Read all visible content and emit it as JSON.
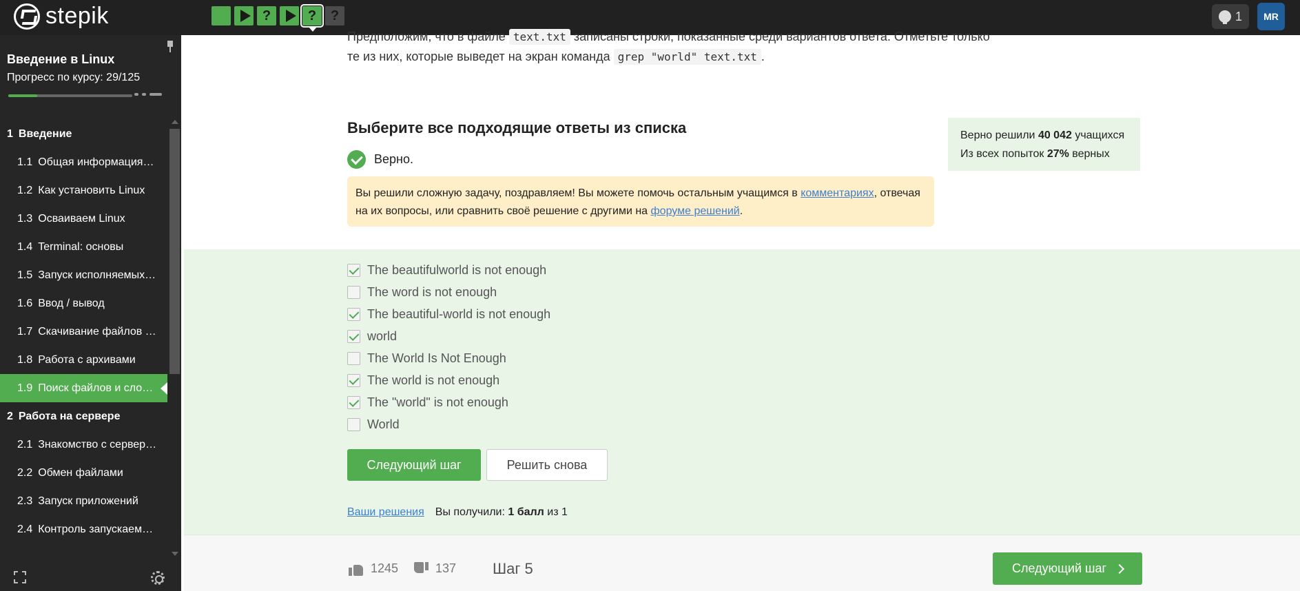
{
  "topbar": {
    "logo_text": "stepik",
    "steps": [
      {
        "type": "text",
        "symbol": ""
      },
      {
        "type": "code",
        "symbol": "play"
      },
      {
        "type": "quiz",
        "symbol": "?"
      },
      {
        "type": "code",
        "symbol": "play"
      },
      {
        "type": "quiz",
        "symbol": "?",
        "active": true
      },
      {
        "type": "quiz",
        "symbol": "?",
        "unsolved": true
      }
    ],
    "notifications_count": "1",
    "avatar_initials": "MR"
  },
  "sidebar": {
    "course_title": "Введение в Linux",
    "progress_label": "Прогресс по курсу:  29/125",
    "progress_fraction": 0.232,
    "toc": [
      {
        "kind": "module",
        "num": "1",
        "title": "Введение"
      },
      {
        "kind": "lesson",
        "num": "1.1",
        "title": "Общая информация о курсе"
      },
      {
        "kind": "lesson",
        "num": "1.2",
        "title": "Как установить Linux"
      },
      {
        "kind": "lesson",
        "num": "1.3",
        "title": "Осваиваем Linux"
      },
      {
        "kind": "lesson",
        "num": "1.4",
        "title": "Terminal: основы"
      },
      {
        "kind": "lesson",
        "num": "1.5",
        "title": "Запуск исполняемых файлов"
      },
      {
        "kind": "lesson",
        "num": "1.6",
        "title": "Ввод / вывод"
      },
      {
        "kind": "lesson",
        "num": "1.7",
        "title": "Скачивание файлов из интернета"
      },
      {
        "kind": "lesson",
        "num": "1.8",
        "title": "Работа с архивами"
      },
      {
        "kind": "lesson",
        "num": "1.9",
        "title": "Поиск файлов и слов в файлах",
        "active": true
      },
      {
        "kind": "module",
        "num": "2",
        "title": "Работа на сервере"
      },
      {
        "kind": "lesson",
        "num": "2.1",
        "title": "Знакомство с сервером"
      },
      {
        "kind": "lesson",
        "num": "2.2",
        "title": "Обмен файлами"
      },
      {
        "kind": "lesson",
        "num": "2.3",
        "title": "Запуск приложений"
      },
      {
        "kind": "lesson",
        "num": "2.4",
        "title": "Контроль запускаемых программ"
      }
    ]
  },
  "task": {
    "intro_part1": "Предположим, что в файле ",
    "intro_code1": "text.txt",
    "intro_part2": " записаны строки, показанные среди вариантов ответа. Отметьте только те из них, которые выведет на экран команда ",
    "intro_code2": "grep \"world\" text.txt",
    "intro_part3": "."
  },
  "question": {
    "title": "Выберите все подходящие ответы из списка",
    "correct_label": "Верно.",
    "alert_part1": "Вы решили сложную задачу, поздравляем! Вы можете помочь остальным учащимся в ",
    "alert_link1": "комментариях",
    "alert_part2": ", отвечая на их вопросы, или сравнить своё решение с другими на ",
    "alert_link2": "форуме решений",
    "alert_part3": "."
  },
  "stats": {
    "line1_prefix": "Верно решили ",
    "line1_count": "40 042",
    "line1_suffix": " учащихся",
    "line2_prefix": "Из всех попыток ",
    "line2_percent": "27%",
    "line2_suffix": " верных"
  },
  "options": [
    {
      "label": "The beautifulworld is not enough",
      "checked": true
    },
    {
      "label": "The word is not enough",
      "checked": false
    },
    {
      "label": "The beautiful-world is not enough",
      "checked": true
    },
    {
      "label": "world",
      "checked": true
    },
    {
      "label": "The World Is Not Enough",
      "checked": false
    },
    {
      "label": "The world is not enough",
      "checked": true
    },
    {
      "label": "The \"world\" is not enough",
      "checked": true
    },
    {
      "label": "World",
      "checked": false
    }
  ],
  "actions": {
    "next_label": "Следующий шаг",
    "retry_label": "Решить снова",
    "solutions_link": "Ваши решения",
    "score_prefix": "Вы получили: ",
    "score_value": "1 балл",
    "score_suffix": " из 1"
  },
  "footer": {
    "likes": "1245",
    "dislikes": "137",
    "step_label": "Шаг 5",
    "next_label": "Следующий шаг"
  },
  "colors": {
    "accent": "#52ad50",
    "link": "#3d7fd1",
    "sidebar_bg": "#262626",
    "topbar_bg": "#212121",
    "alert_bg": "#ffefc8",
    "options_bg": "#e8f5e7"
  }
}
